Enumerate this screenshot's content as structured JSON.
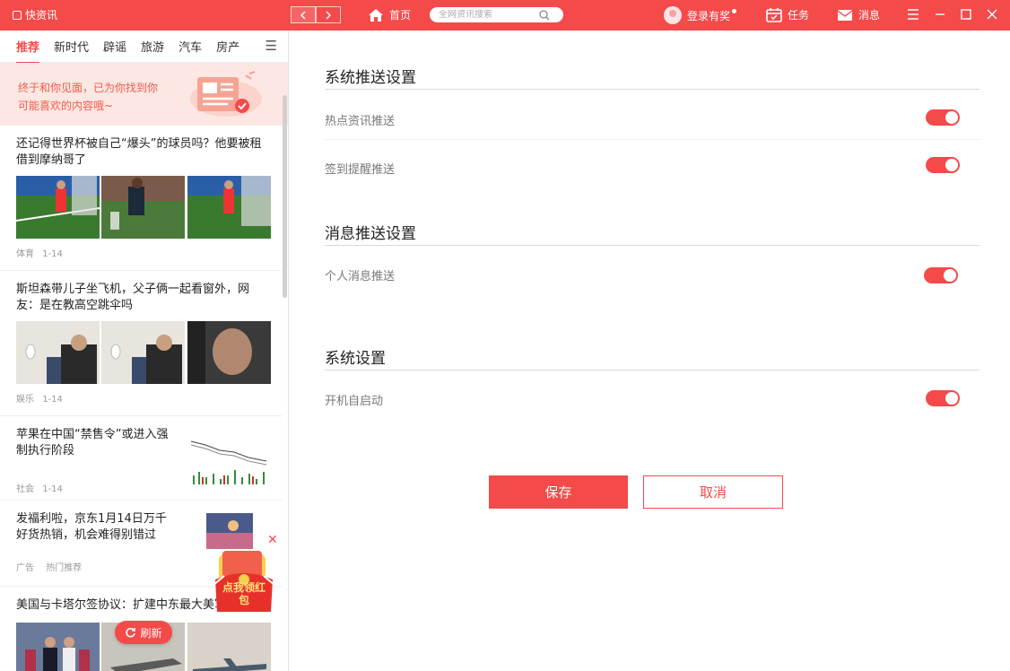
{
  "app": {
    "name": "快资讯"
  },
  "titlebar": {
    "home_label": "首页",
    "search_placeholder": "全网资讯搜索",
    "login_label": "登录有奖",
    "task_label": "任务",
    "message_label": "消息"
  },
  "sidebar": {
    "tabs": [
      {
        "label": "推荐"
      },
      {
        "label": "新时代"
      },
      {
        "label": "辟谣"
      },
      {
        "label": "旅游"
      },
      {
        "label": "汽车"
      },
      {
        "label": "房产"
      }
    ],
    "banner_text": "终于和你见面，已为你找到你可能喜欢的内容哦~",
    "news": [
      {
        "title": "还记得世界杯被自己“爆头”的球员吗？他要被租借到摩纳哥了",
        "category": "体育",
        "date": "1-14"
      },
      {
        "title": "斯坦森带儿子坐飞机，父子俩一起看窗外，网友：是在教高空跳伞吗",
        "category": "娱乐",
        "date": "1-14"
      },
      {
        "title": "苹果在中国“禁售令”或进入强制执行阶段",
        "category": "社会",
        "date": "1-14"
      },
      {
        "title": "发福利啦，京东1月14日万千好货热销，机会难得别错过",
        "category": "广告",
        "date": "热门推荐"
      },
      {
        "title": "美国与卡塔尔签协议：扩建中东最大美军"
      }
    ],
    "refresh_label": "刷新",
    "redpacket_text": "点我领红包"
  },
  "settings": {
    "sections": [
      {
        "title": "系统推送设置",
        "options": [
          {
            "label": "热点资讯推送",
            "on": true
          },
          {
            "label": "签到提醒推送",
            "on": true
          }
        ]
      },
      {
        "title": "消息推送设置",
        "options": [
          {
            "label": "个人消息推送",
            "on": true
          }
        ]
      },
      {
        "title": "系统设置",
        "options": [
          {
            "label": "开机自启动",
            "on": true
          }
        ]
      }
    ],
    "save_label": "保存",
    "cancel_label": "取消"
  },
  "colors": {
    "accent": "#f44a4a",
    "banner_bg": "#fde7e3"
  }
}
